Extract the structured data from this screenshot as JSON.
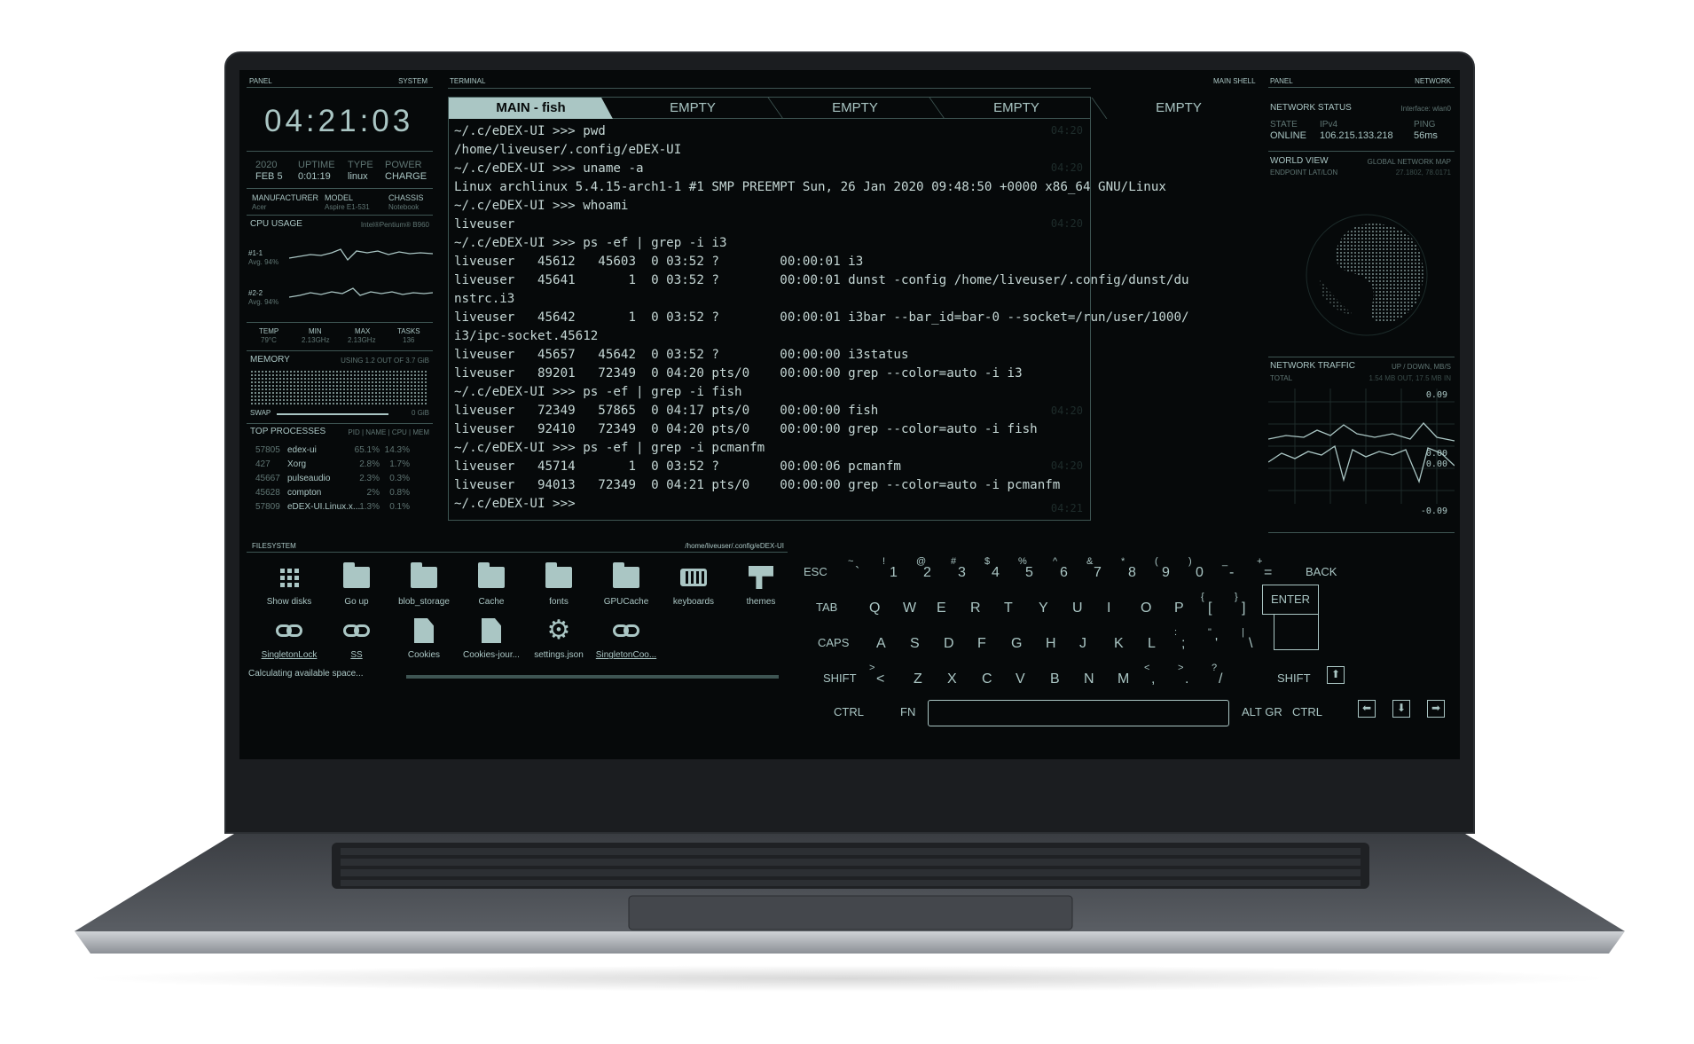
{
  "system_panel": {
    "panel_label": "PANEL",
    "panel_title": "SYSTEM",
    "clock": "04:21:03",
    "date_year": "2020",
    "date_day": "FEB 5",
    "uptime_label": "UPTIME",
    "uptime": "0:01:19",
    "type_label": "TYPE",
    "type": "linux",
    "power_label": "POWER",
    "power": "CHARGE",
    "manufacturer_label": "MANUFACTURER",
    "manufacturer": "Acer",
    "model_label": "MODEL",
    "model": "Aspire E1-531",
    "chassis_label": "CHASSIS",
    "chassis": "Notebook",
    "cpu_label": "CPU USAGE",
    "cpu_name": "Intel®Pentium® B960",
    "core1_label": "#1-1",
    "core1_avg": "Avg. 94%",
    "core2_label": "#2-2",
    "core2_avg": "Avg. 94%",
    "temp_label": "TEMP",
    "temp": "79°C",
    "min_label": "MIN",
    "min": "2.13GHz",
    "max_label": "MAX",
    "max": "2.13GHz",
    "tasks_label": "TASKS",
    "tasks": "136",
    "memory_label": "MEMORY",
    "memory_usage": "USING 1.2 OUT OF 3.7 GiB",
    "swap_label": "SWAP",
    "swap_value": "0 GiB",
    "top_label": "TOP PROCESSES",
    "top_columns": "PID | NAME | CPU | MEM",
    "processes": [
      {
        "pid": "57805",
        "name": "edex-ui",
        "cpu": "65.1%",
        "mem": "14.3%"
      },
      {
        "pid": "427",
        "name": "Xorg",
        "cpu": "2.8%",
        "mem": "1.7%"
      },
      {
        "pid": "45667",
        "name": "pulseaudio",
        "cpu": "2.3%",
        "mem": "0.3%"
      },
      {
        "pid": "45628",
        "name": "compton",
        "cpu": "2%",
        "mem": "0.8%"
      },
      {
        "pid": "57809",
        "name": "eDEX-UI.Linux.x...",
        "cpu": "1.3%",
        "mem": "0.1%"
      }
    ]
  },
  "terminal": {
    "panel_label": "TERMINAL",
    "panel_title": "MAIN SHELL",
    "tabs": [
      "MAIN - fish",
      "EMPTY",
      "EMPTY",
      "EMPTY",
      "EMPTY"
    ],
    "lines": [
      "~/.c/eDEX-UI >>> pwd",
      "/home/liveuser/.config/eDEX-UI",
      "~/.c/eDEX-UI >>> uname -a",
      "Linux archlinux 5.4.15-arch1-1 #1 SMP PREEMPT Sun, 26 Jan 2020 09:48:50 +0000 x86_64 GNU/Linux",
      "~/.c/eDEX-UI >>> whoami",
      "liveuser",
      "~/.c/eDEX-UI >>> ps -ef | grep -i i3",
      "liveuser   45612   45603  0 03:52 ?        00:00:01 i3",
      "liveuser   45641       1  0 03:52 ?        00:00:01 dunst -config /home/liveuser/.config/dunst/du",
      "nstrc.i3",
      "liveuser   45642       1  0 03:52 ?        00:00:01 i3bar --bar_id=bar-0 --socket=/run/user/1000/",
      "i3/ipc-socket.45612",
      "liveuser   45657   45642  0 03:52 ?        00:00:00 i3status",
      "liveuser   89201   72349  0 04:20 pts/0    00:00:00 grep --color=auto -i i3",
      "~/.c/eDEX-UI >>> ps -ef | grep -i fish",
      "liveuser   72349   57865  0 04:17 pts/0    00:00:00 fish",
      "liveuser   92410   72349  0 04:20 pts/0    00:00:00 grep --color=auto -i fish",
      "~/.c/eDEX-UI >>> ps -ef | grep -i pcmanfm",
      "liveuser   45714       1  0 03:52 ?        00:00:06 pcmanfm",
      "liveuser   94013   72349  0 04:21 pts/0    00:00:00 grep --color=auto -i pcmanfm",
      "~/.c/eDEX-UI >>>"
    ],
    "ghost_times": [
      "04:20",
      "04:20",
      "04:20",
      "04:20",
      "04:20",
      "04:21"
    ]
  },
  "network_panel": {
    "panel_label": "PANEL",
    "panel_title": "NETWORK",
    "status_label": "NETWORK STATUS",
    "interface": "Interface: wlan0",
    "state_label": "STATE",
    "state": "ONLINE",
    "ipv4_label": "IPv4",
    "ipv4": "106.215.133.218",
    "ping_label": "PING",
    "ping": "56ms",
    "world_label": "WORLD VIEW",
    "world_sub": "GLOBAL NETWORK MAP",
    "endpoint_label": "ENDPOINT LAT/LON",
    "endpoint": "27.1802, 78.0171",
    "traffic_label": "NETWORK TRAFFIC",
    "traffic_sub": "UP / DOWN, MB/S",
    "total_label": "TOTAL",
    "total": "1.54 MB OUT, 17.5 MB IN",
    "scale_top": "0.09",
    "scale_mid1": "0.00",
    "scale_mid2": "0.00",
    "scale_bottom": "-0.09"
  },
  "filesystem": {
    "panel_label": "FILESYSTEM",
    "path": "/home/liveuser/.config/eDEX-UI",
    "items_row1": [
      {
        "label": "Show disks",
        "icon": "grid-icon"
      },
      {
        "label": "Go up",
        "icon": "folder-up-icon"
      },
      {
        "label": "blob_storage",
        "icon": "folder-icon"
      },
      {
        "label": "Cache",
        "icon": "folder-icon"
      },
      {
        "label": "fonts",
        "icon": "folder-icon"
      },
      {
        "label": "GPUCache",
        "icon": "folder-icon"
      },
      {
        "label": "keyboards",
        "icon": "keyboard-icon"
      },
      {
        "label": "themes",
        "icon": "themes-icon"
      }
    ],
    "items_row2": [
      {
        "label": "SingletonLock",
        "icon": "link-icon"
      },
      {
        "label": "SS",
        "icon": "link-icon"
      },
      {
        "label": "Cookies",
        "icon": "file-icon"
      },
      {
        "label": "Cookies-jour...",
        "icon": "file-icon"
      },
      {
        "label": "settings.json",
        "icon": "gear-icon"
      },
      {
        "label": "SingletonCoo...",
        "icon": "link-icon"
      }
    ],
    "status": "Calculating available space..."
  },
  "keyboard": {
    "row1": [
      "ESC",
      "`",
      "1",
      "2",
      "3",
      "4",
      "5",
      "6",
      "7",
      "8",
      "9",
      "0",
      "-",
      "=",
      "BACK"
    ],
    "row1_shift": [
      "",
      "~",
      "!",
      "@",
      "#",
      "$",
      "%",
      "^",
      "&",
      "*",
      "(",
      ")",
      "_",
      "+",
      ""
    ],
    "row2": [
      "TAB",
      "Q",
      "W",
      "E",
      "R",
      "T",
      "Y",
      "U",
      "I",
      "O",
      "P",
      "[",
      "]",
      "ENTER"
    ],
    "row2_shift": [
      "",
      "",
      "",
      "",
      "",
      "",
      "",
      "",
      "",
      "",
      "",
      "{",
      "}",
      ""
    ],
    "row3": [
      "CAPS",
      "A",
      "S",
      "D",
      "F",
      "G",
      "H",
      "J",
      "K",
      "L",
      ";",
      "'",
      "\\"
    ],
    "row3_shift": [
      "",
      "",
      "",
      "",
      "",
      "",
      "",
      "",
      "",
      "",
      ":",
      "\"",
      "|"
    ],
    "row4": [
      "SHIFT",
      "<",
      "Z",
      "X",
      "C",
      "V",
      "B",
      "N",
      "M",
      ",",
      ".",
      "/",
      "SHIFT"
    ],
    "row4_shift": [
      "",
      ">",
      "",
      "",
      "",
      "",
      "",
      "",
      "",
      "<",
      ">",
      "?",
      ""
    ],
    "ctrl": "CTRL",
    "fn": "FN",
    "altgr": "ALT GR",
    "ctrl_right": "CTRL"
  },
  "colors": {
    "accent": "#aac6c4",
    "background": "#06090a",
    "bezel": "#1b1d20"
  }
}
